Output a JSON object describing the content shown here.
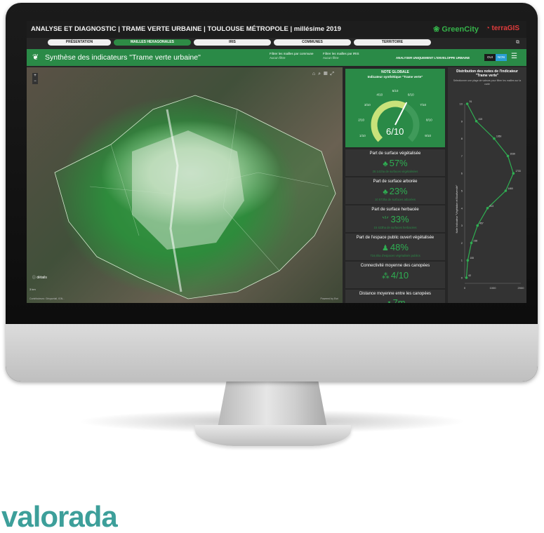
{
  "app": {
    "title": "ANALYSE ET DIAGNOSTIC | TRAME VERTE URBAINE | TOULOUSE MÉTROPOLE | millésime 2019",
    "logo_greencity": "GreenCity",
    "logo_terra": "terraGIS"
  },
  "tabs": [
    {
      "label": "PRÉSENTATION",
      "active": false
    },
    {
      "label": "MAILLES HEXAGONALES",
      "active": true
    },
    {
      "label": "IRIS",
      "active": false
    },
    {
      "label": "COMMUNES",
      "active": false
    },
    {
      "label": "TERRITOIRE",
      "active": false
    }
  ],
  "header": {
    "title": "Synthèse des indicateurs \"Trame verte urbaine\"",
    "filter_communes_label": "Filtrer les mailles par commune",
    "filter_communes_value": "Aucun filtre",
    "filter_iris_label": "Filtrer les mailles par IRIS",
    "filter_iris_value": "Aucun filtre",
    "envelope_label": "ANALYSER UNIQUEMENT L'ENVELOPPE URBAINE",
    "toggle_oui": "OUI",
    "toggle_non": "NON"
  },
  "map": {
    "details_label": "détails",
    "scale_label": "3 km",
    "credit": "Contributeurs: Géoportail, IGN...",
    "powered": "Powered by Esri"
  },
  "gauge": {
    "title": "NOTE GLOBALE",
    "subtitle": "Indicateur synthétique \"Trame verte\"",
    "value_label": "6/10",
    "value": 6,
    "max": 10,
    "ticks": [
      "0/10",
      "1/10",
      "2/10",
      "3/10",
      "4/10",
      "5/10",
      "6/10",
      "7/10",
      "8/10",
      "9/10",
      "10/10"
    ]
  },
  "cards": [
    {
      "label": "Part de surface végétalisée",
      "value": "57%",
      "icon": "tree-icon",
      "sub": "26 141ha de surfaces végétalisées"
    },
    {
      "label": "Part de surface arborée",
      "value": "23%",
      "icon": "tree-icon",
      "sub": "10 573ha de surfaces arborées"
    },
    {
      "label": "Part de surface herbacée",
      "value": "33%",
      "icon": "grass-icon",
      "sub": "15 423ha de surfaces herbacées"
    },
    {
      "label": "Part de l'espace public ouvert végétalisée",
      "value": "48%",
      "icon": "people-icon",
      "sub": "716,6ha d'espaces végétalisés publics"
    },
    {
      "label": "Connectivité moyenne des canopées",
      "value": "4/10",
      "icon": "network-icon",
      "sub": ""
    },
    {
      "label": "Distance moyenne entre les canopées",
      "value": "7m",
      "icon": "arrow-icon",
      "sub": ""
    }
  ],
  "distribution": {
    "title": "Distribution des notes de l'indicateur \"Trame verte\"",
    "subtitle": "Sélectionner une plage de valeurs pour filtrer les mailles sur la carte",
    "y_axis_label": "Note Indicateur \"Végétation et Biodiversité\""
  },
  "chart_data": {
    "type": "line",
    "title": "Distribution des notes de l'indicateur \"Trame verte\"",
    "ylabel": "Note Indicateur \"Végétation et Biodiversité\"",
    "xlabel": "",
    "y": [
      10,
      9,
      8,
      7,
      6,
      5,
      4,
      3,
      2,
      1,
      0
    ],
    "x": [
      91,
      415,
      1050,
      1539,
      1733,
      1460,
      813,
      457,
      238,
      108,
      62
    ],
    "xlim": [
      0,
      2000
    ],
    "x_ticks": [
      "0",
      "1000",
      "2000"
    ],
    "ylim": [
      0,
      10
    ],
    "y_ticks": [
      "10",
      "9",
      "8",
      "7",
      "6",
      "5",
      "4",
      "3",
      "2",
      "1",
      "0"
    ],
    "grid": false,
    "colors": {
      "line": "#2fae52",
      "marker": "#2fae52"
    }
  },
  "brand": {
    "text": "valorada"
  }
}
